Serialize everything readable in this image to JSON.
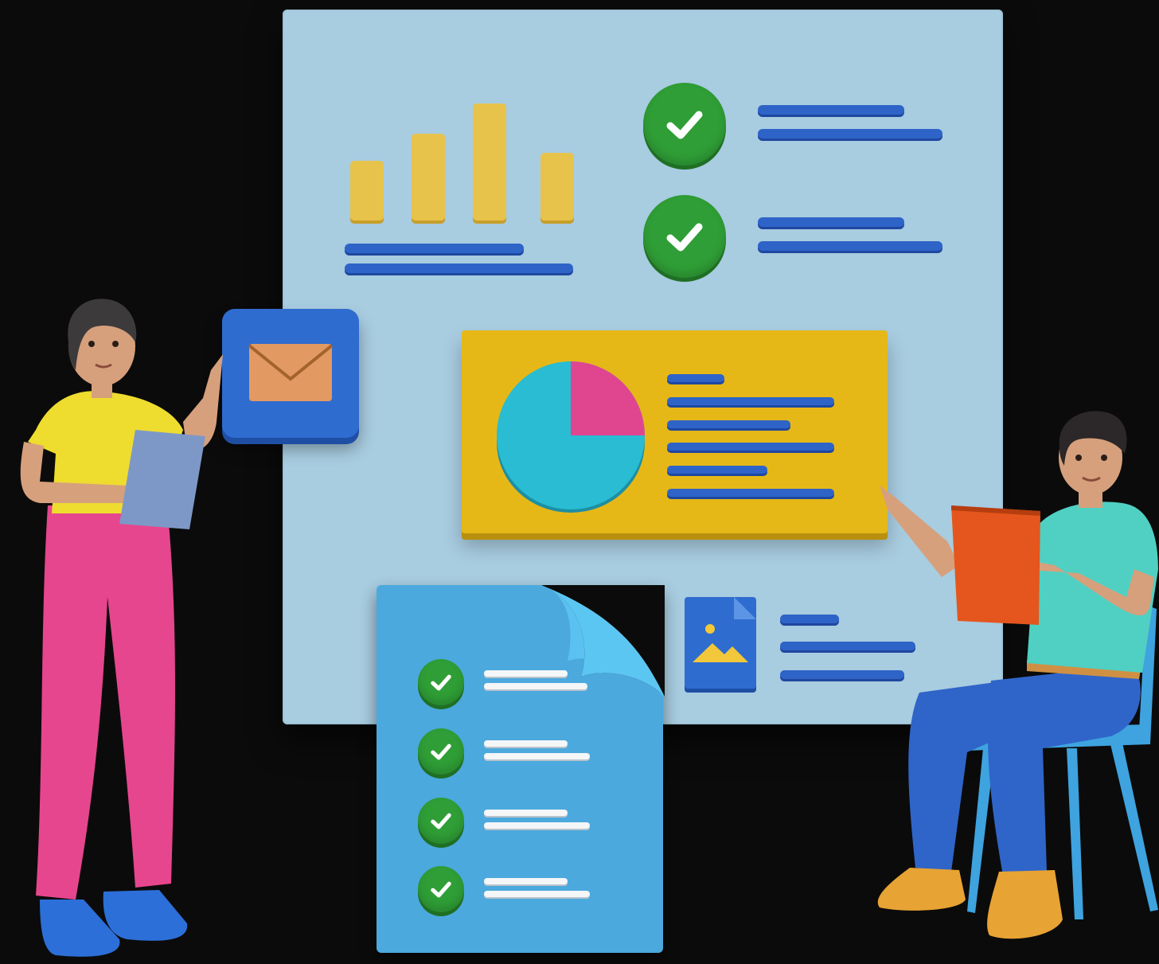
{
  "illustration": {
    "theme": "3d-characters-reviewing-dashboard-board",
    "background_color": "#0b0b0b",
    "board_color": "#a8cce0",
    "accent_colors": {
      "bars": "#e7c34b",
      "lines": "#2e64c7",
      "check": "#2f9e36",
      "pie_main": "#29bcd2",
      "pie_slice": "#e0468f",
      "card_yellow": "#e6b817",
      "document": "#4ba9dd"
    },
    "icons": [
      "bar-chart-icon",
      "check-icon",
      "pie-chart-icon",
      "mail-icon",
      "image-file-icon",
      "document-icon"
    ],
    "figures": [
      "woman-standing-with-tablet",
      "man-seated-with-clipboard"
    ]
  }
}
